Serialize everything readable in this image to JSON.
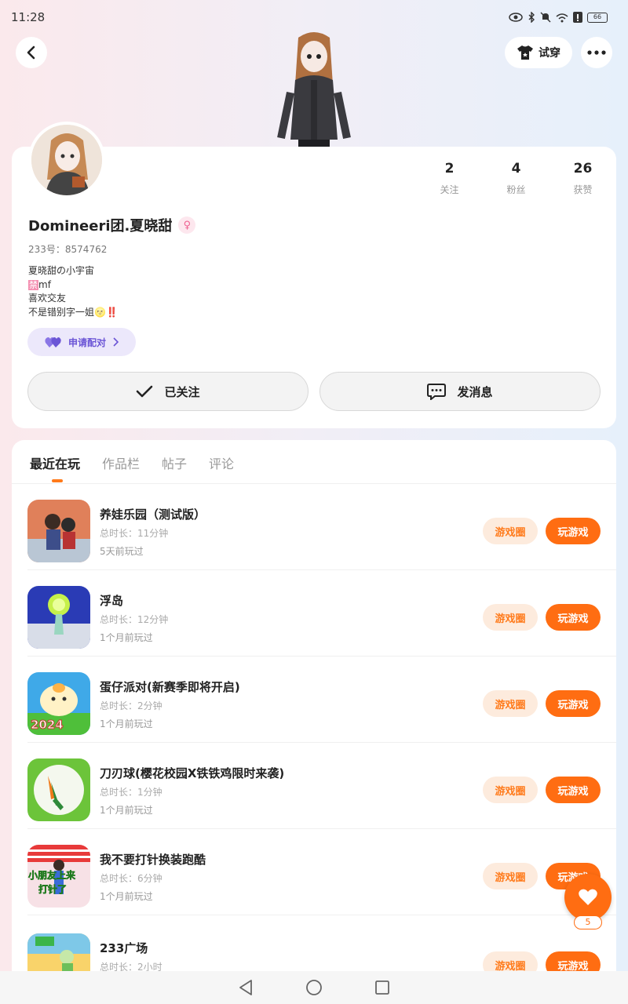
{
  "status_bar": {
    "time": "11:28",
    "battery": "66"
  },
  "header": {
    "tryon_label": "试穿"
  },
  "profile": {
    "username": "Domineeri团.夏晓甜",
    "gender_symbol": "♀",
    "user_id": "233号：8574762",
    "bio": {
      "line1": "夏晓甜の小宇宙",
      "line2_badge": "禁",
      "line2_text": "mf",
      "line3": "喜欢交友",
      "line4_text": "不是错别字一姐",
      "line4_emoji": "🌝",
      "line4_mark": "‼️"
    },
    "pair_label": "申请配对",
    "follow_label": "已关注",
    "message_label": "发消息",
    "stats": [
      {
        "value": "2",
        "label": "关注"
      },
      {
        "value": "4",
        "label": "粉丝"
      },
      {
        "value": "26",
        "label": "获赞"
      }
    ]
  },
  "tabs": [
    {
      "label": "最近在玩",
      "active": true
    },
    {
      "label": "作品栏",
      "active": false
    },
    {
      "label": "帖子",
      "active": false
    },
    {
      "label": "评论",
      "active": false
    }
  ],
  "games": [
    {
      "title": "养娃乐园（测试版）",
      "duration": "总时长：11分钟",
      "last_played": "5天前玩过",
      "circle_label": "游戏圈",
      "play_label": "玩游戏"
    },
    {
      "title": "浮岛",
      "duration": "总时长：12分钟",
      "last_played": "1个月前玩过",
      "circle_label": "游戏圈",
      "play_label": "玩游戏"
    },
    {
      "title": "蛋仔派对(新赛季即将开启)",
      "duration": "总时长：2分钟",
      "last_played": "1个月前玩过",
      "circle_label": "游戏圈",
      "play_label": "玩游戏",
      "icon_text": "2024"
    },
    {
      "title": "刀刃球(樱花校园X铁铁鸡限时来袭)",
      "duration": "总时长：1分钟",
      "last_played": "1个月前玩过",
      "circle_label": "游戏圈",
      "play_label": "玩游戏"
    },
    {
      "title": "我不要打针换装跑酷",
      "duration": "总时长：6分钟",
      "last_played": "1个月前玩过",
      "circle_label": "游戏圈",
      "play_label": "玩游戏",
      "icon_text_1": "小朋友上来",
      "icon_text_2": "打针了"
    },
    {
      "title": "233广场",
      "duration": "总时长：2小时",
      "last_played": "",
      "circle_label": "游戏圈",
      "play_label": "玩游戏"
    }
  ],
  "like_fab": {
    "count": "5"
  },
  "colors": {
    "accent": "#ff6d12",
    "accent_light": "#fdebdd",
    "pair_purple": "#6b55d6"
  }
}
